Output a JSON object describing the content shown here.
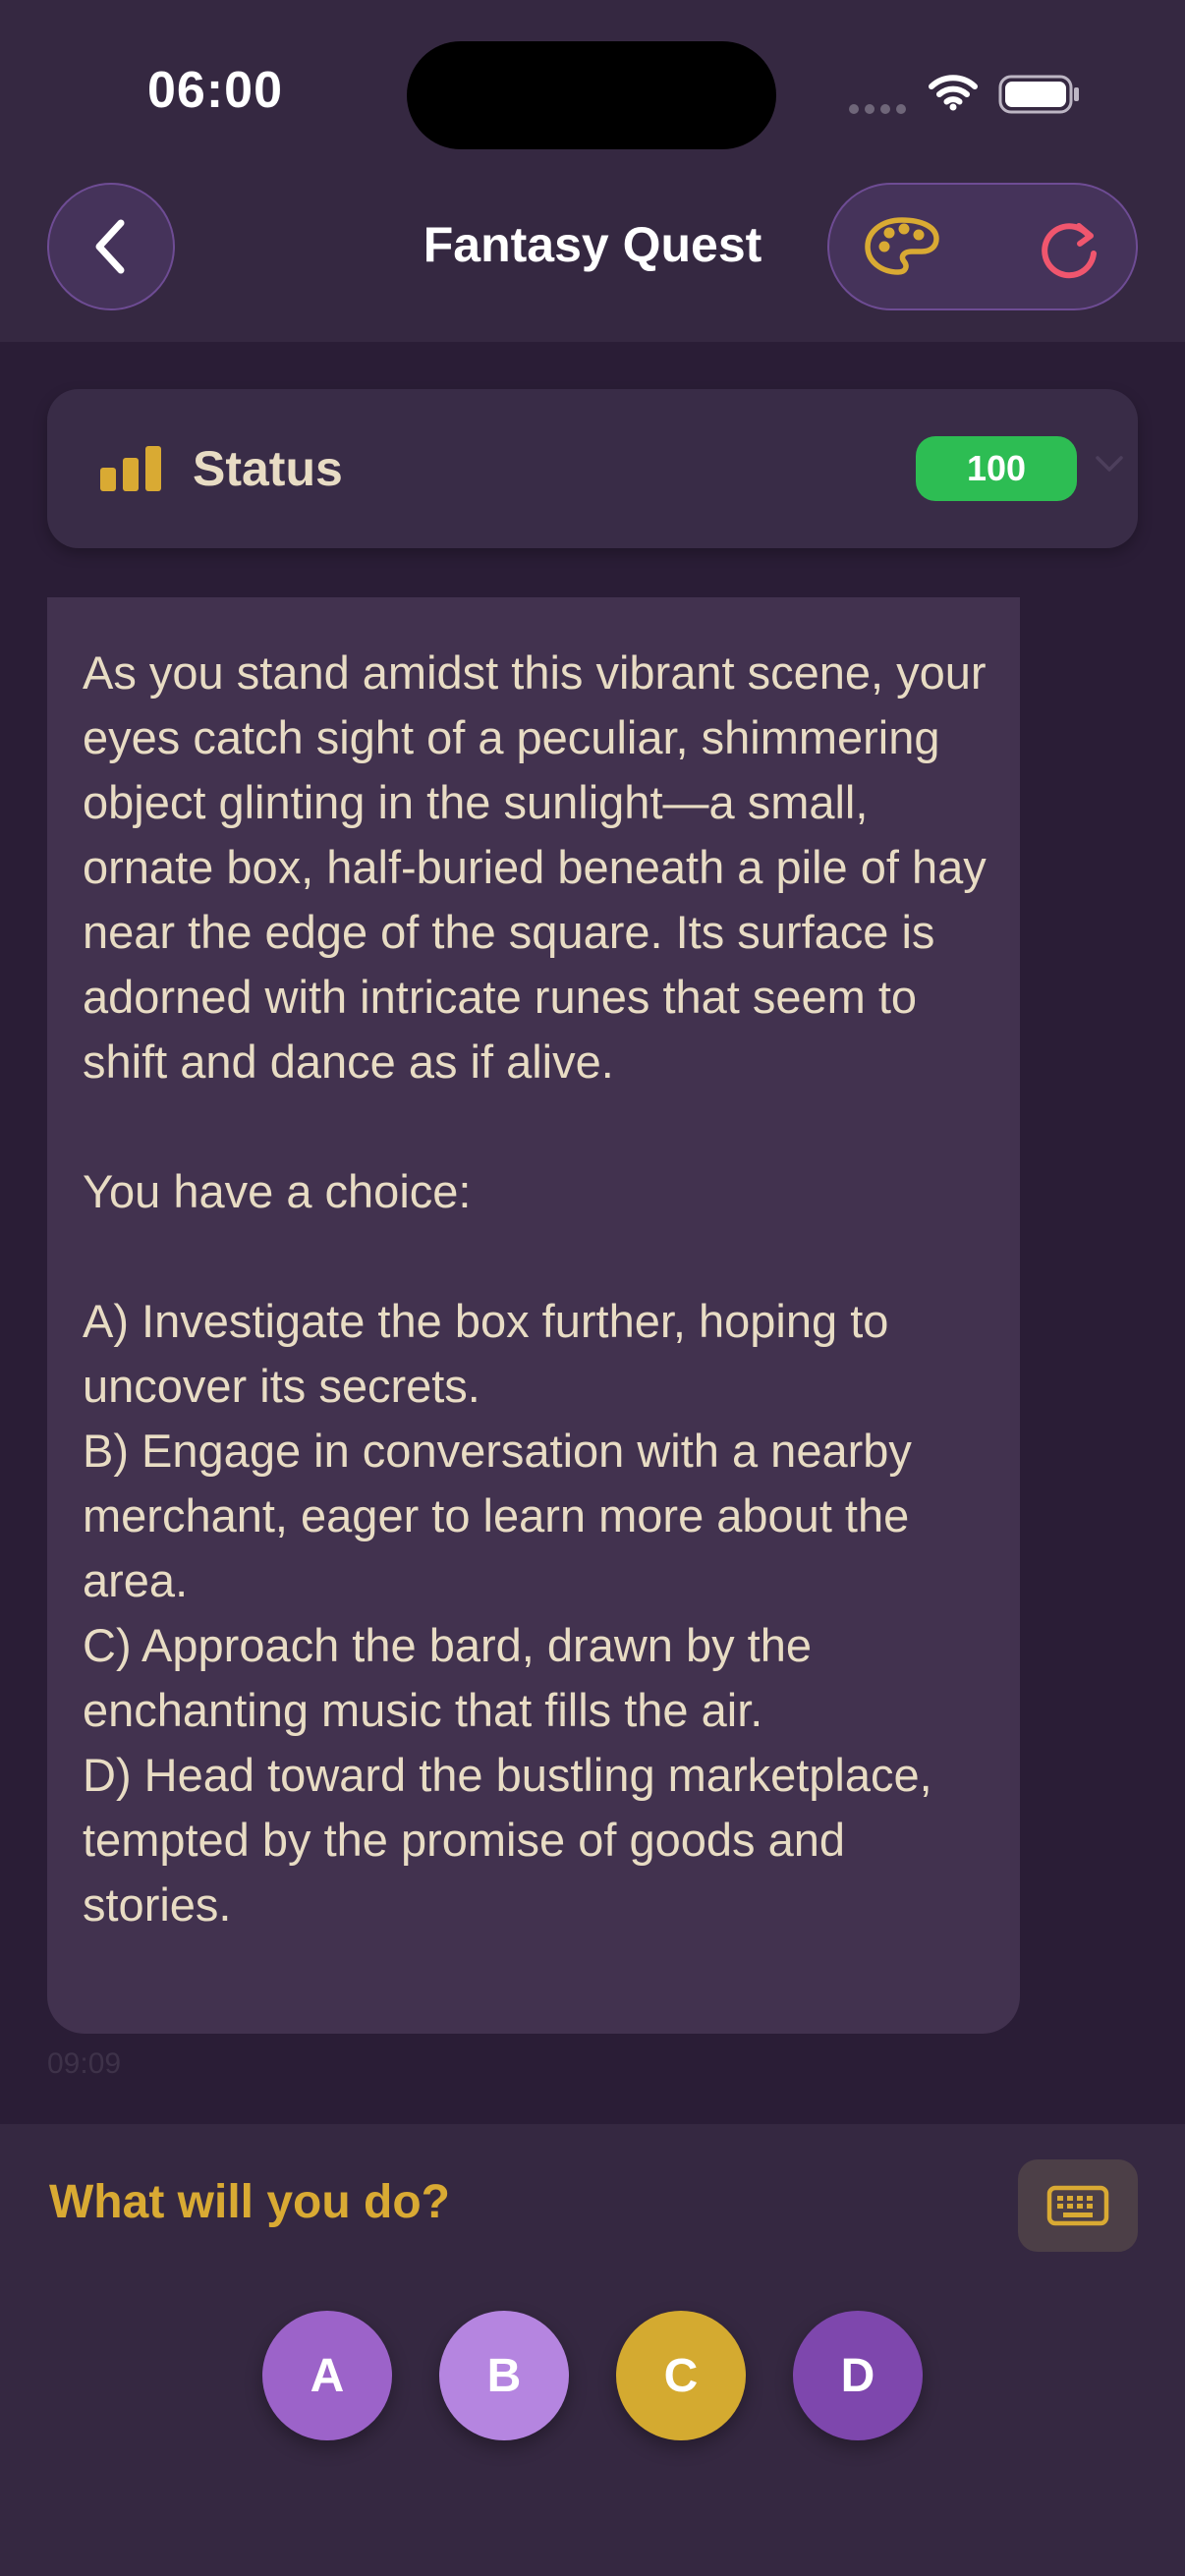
{
  "status_bar": {
    "time": "06:00"
  },
  "nav": {
    "title": "Fantasy Quest",
    "back_icon": "chevron-left-icon",
    "palette_icon": "palette-icon",
    "refresh_icon": "refresh-icon"
  },
  "status": {
    "label": "Status",
    "value": "100",
    "icon": "bar-chart-icon",
    "expand_icon": "chevron-down-icon"
  },
  "message": {
    "text": "As you stand amidst this vibrant scene, your eyes catch sight of a peculiar, shimmering object glinting in the sunlight—a small, ornate box, half-buried beneath a pile of hay near the edge of the square. Its surface is adorned with intricate runes that seem to shift and dance as if alive.\n\nYou have a choice:\n\nA) Investigate the box further, hoping to uncover its secrets.\nB) Engage in conversation with a nearby merchant, eager to learn more about the area.\nC) Approach the bard, drawn by the enchanting music that fills the air.\nD) Head toward the bustling marketplace, tempted by the promise of goods and stories.",
    "timestamp": "09:09"
  },
  "prompt": {
    "label": "What will you do?",
    "keyboard_icon": "keyboard-icon"
  },
  "choices": [
    {
      "label": "A",
      "color": "#9c63c9"
    },
    {
      "label": "B",
      "color": "#b585e0"
    },
    {
      "label": "C",
      "color": "#d4aa30"
    },
    {
      "label": "D",
      "color": "#7e47ad"
    }
  ],
  "colors": {
    "background": "#2a1d36",
    "header": "#352841",
    "accent_gold": "#d9aa33",
    "badge_green": "#2dbd53",
    "refresh_pink": "#f0566e"
  }
}
